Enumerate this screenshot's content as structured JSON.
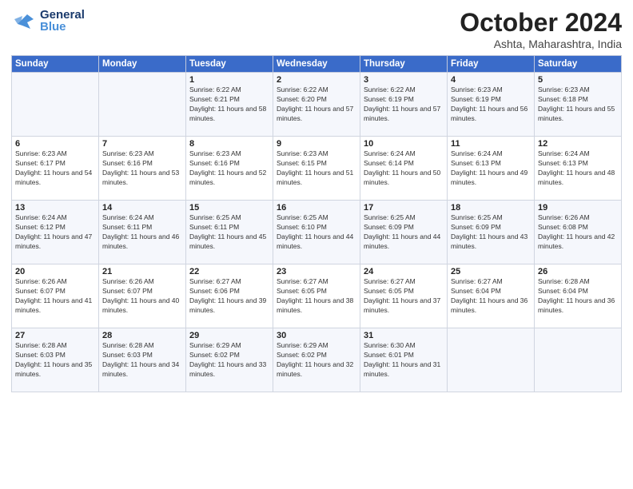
{
  "header": {
    "logo_general": "General",
    "logo_blue": "Blue",
    "month": "October 2024",
    "location": "Ashta, Maharashtra, India"
  },
  "days_of_week": [
    "Sunday",
    "Monday",
    "Tuesday",
    "Wednesday",
    "Thursday",
    "Friday",
    "Saturday"
  ],
  "weeks": [
    [
      {
        "day": "",
        "sunrise": "",
        "sunset": "",
        "daylight": ""
      },
      {
        "day": "",
        "sunrise": "",
        "sunset": "",
        "daylight": ""
      },
      {
        "day": "1",
        "sunrise": "Sunrise: 6:22 AM",
        "sunset": "Sunset: 6:21 PM",
        "daylight": "Daylight: 11 hours and 58 minutes."
      },
      {
        "day": "2",
        "sunrise": "Sunrise: 6:22 AM",
        "sunset": "Sunset: 6:20 PM",
        "daylight": "Daylight: 11 hours and 57 minutes."
      },
      {
        "day": "3",
        "sunrise": "Sunrise: 6:22 AM",
        "sunset": "Sunset: 6:19 PM",
        "daylight": "Daylight: 11 hours and 57 minutes."
      },
      {
        "day": "4",
        "sunrise": "Sunrise: 6:23 AM",
        "sunset": "Sunset: 6:19 PM",
        "daylight": "Daylight: 11 hours and 56 minutes."
      },
      {
        "day": "5",
        "sunrise": "Sunrise: 6:23 AM",
        "sunset": "Sunset: 6:18 PM",
        "daylight": "Daylight: 11 hours and 55 minutes."
      }
    ],
    [
      {
        "day": "6",
        "sunrise": "Sunrise: 6:23 AM",
        "sunset": "Sunset: 6:17 PM",
        "daylight": "Daylight: 11 hours and 54 minutes."
      },
      {
        "day": "7",
        "sunrise": "Sunrise: 6:23 AM",
        "sunset": "Sunset: 6:16 PM",
        "daylight": "Daylight: 11 hours and 53 minutes."
      },
      {
        "day": "8",
        "sunrise": "Sunrise: 6:23 AM",
        "sunset": "Sunset: 6:16 PM",
        "daylight": "Daylight: 11 hours and 52 minutes."
      },
      {
        "day": "9",
        "sunrise": "Sunrise: 6:23 AM",
        "sunset": "Sunset: 6:15 PM",
        "daylight": "Daylight: 11 hours and 51 minutes."
      },
      {
        "day": "10",
        "sunrise": "Sunrise: 6:24 AM",
        "sunset": "Sunset: 6:14 PM",
        "daylight": "Daylight: 11 hours and 50 minutes."
      },
      {
        "day": "11",
        "sunrise": "Sunrise: 6:24 AM",
        "sunset": "Sunset: 6:13 PM",
        "daylight": "Daylight: 11 hours and 49 minutes."
      },
      {
        "day": "12",
        "sunrise": "Sunrise: 6:24 AM",
        "sunset": "Sunset: 6:13 PM",
        "daylight": "Daylight: 11 hours and 48 minutes."
      }
    ],
    [
      {
        "day": "13",
        "sunrise": "Sunrise: 6:24 AM",
        "sunset": "Sunset: 6:12 PM",
        "daylight": "Daylight: 11 hours and 47 minutes."
      },
      {
        "day": "14",
        "sunrise": "Sunrise: 6:24 AM",
        "sunset": "Sunset: 6:11 PM",
        "daylight": "Daylight: 11 hours and 46 minutes."
      },
      {
        "day": "15",
        "sunrise": "Sunrise: 6:25 AM",
        "sunset": "Sunset: 6:11 PM",
        "daylight": "Daylight: 11 hours and 45 minutes."
      },
      {
        "day": "16",
        "sunrise": "Sunrise: 6:25 AM",
        "sunset": "Sunset: 6:10 PM",
        "daylight": "Daylight: 11 hours and 44 minutes."
      },
      {
        "day": "17",
        "sunrise": "Sunrise: 6:25 AM",
        "sunset": "Sunset: 6:09 PM",
        "daylight": "Daylight: 11 hours and 44 minutes."
      },
      {
        "day": "18",
        "sunrise": "Sunrise: 6:25 AM",
        "sunset": "Sunset: 6:09 PM",
        "daylight": "Daylight: 11 hours and 43 minutes."
      },
      {
        "day": "19",
        "sunrise": "Sunrise: 6:26 AM",
        "sunset": "Sunset: 6:08 PM",
        "daylight": "Daylight: 11 hours and 42 minutes."
      }
    ],
    [
      {
        "day": "20",
        "sunrise": "Sunrise: 6:26 AM",
        "sunset": "Sunset: 6:07 PM",
        "daylight": "Daylight: 11 hours and 41 minutes."
      },
      {
        "day": "21",
        "sunrise": "Sunrise: 6:26 AM",
        "sunset": "Sunset: 6:07 PM",
        "daylight": "Daylight: 11 hours and 40 minutes."
      },
      {
        "day": "22",
        "sunrise": "Sunrise: 6:27 AM",
        "sunset": "Sunset: 6:06 PM",
        "daylight": "Daylight: 11 hours and 39 minutes."
      },
      {
        "day": "23",
        "sunrise": "Sunrise: 6:27 AM",
        "sunset": "Sunset: 6:05 PM",
        "daylight": "Daylight: 11 hours and 38 minutes."
      },
      {
        "day": "24",
        "sunrise": "Sunrise: 6:27 AM",
        "sunset": "Sunset: 6:05 PM",
        "daylight": "Daylight: 11 hours and 37 minutes."
      },
      {
        "day": "25",
        "sunrise": "Sunrise: 6:27 AM",
        "sunset": "Sunset: 6:04 PM",
        "daylight": "Daylight: 11 hours and 36 minutes."
      },
      {
        "day": "26",
        "sunrise": "Sunrise: 6:28 AM",
        "sunset": "Sunset: 6:04 PM",
        "daylight": "Daylight: 11 hours and 36 minutes."
      }
    ],
    [
      {
        "day": "27",
        "sunrise": "Sunrise: 6:28 AM",
        "sunset": "Sunset: 6:03 PM",
        "daylight": "Daylight: 11 hours and 35 minutes."
      },
      {
        "day": "28",
        "sunrise": "Sunrise: 6:28 AM",
        "sunset": "Sunset: 6:03 PM",
        "daylight": "Daylight: 11 hours and 34 minutes."
      },
      {
        "day": "29",
        "sunrise": "Sunrise: 6:29 AM",
        "sunset": "Sunset: 6:02 PM",
        "daylight": "Daylight: 11 hours and 33 minutes."
      },
      {
        "day": "30",
        "sunrise": "Sunrise: 6:29 AM",
        "sunset": "Sunset: 6:02 PM",
        "daylight": "Daylight: 11 hours and 32 minutes."
      },
      {
        "day": "31",
        "sunrise": "Sunrise: 6:30 AM",
        "sunset": "Sunset: 6:01 PM",
        "daylight": "Daylight: 11 hours and 31 minutes."
      },
      {
        "day": "",
        "sunrise": "",
        "sunset": "",
        "daylight": ""
      },
      {
        "day": "",
        "sunrise": "",
        "sunset": "",
        "daylight": ""
      }
    ]
  ]
}
